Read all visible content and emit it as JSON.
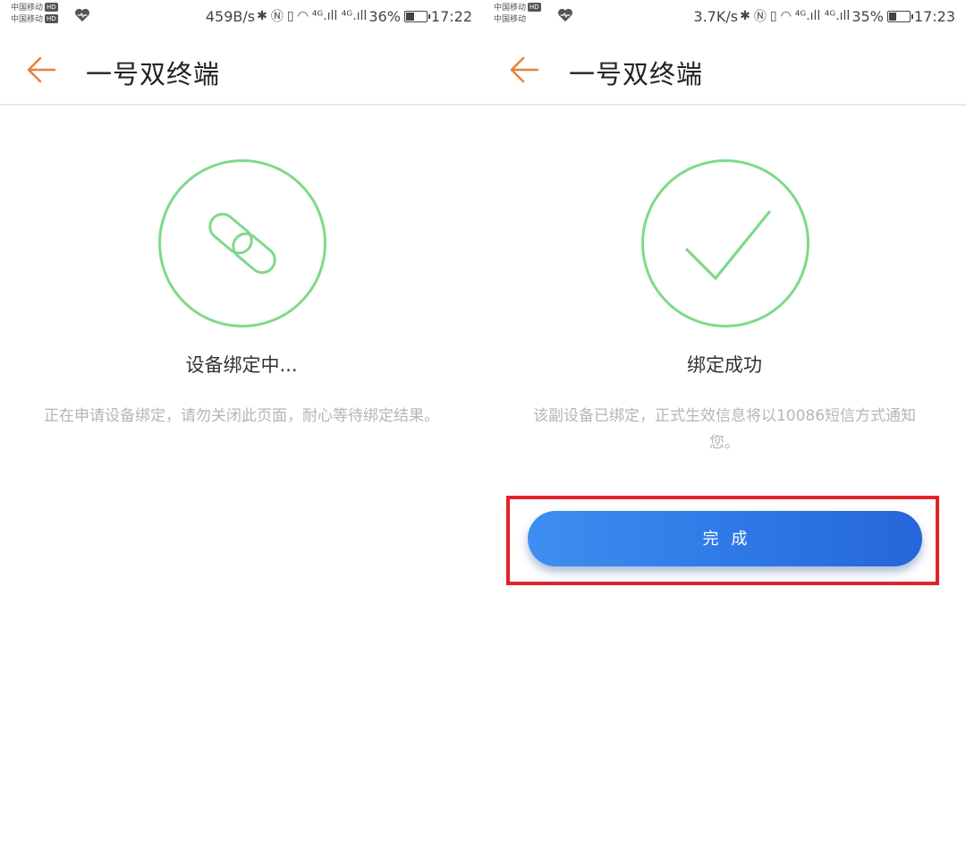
{
  "left": {
    "status": {
      "carrier1": "中国移动",
      "carrier2": "中国移动",
      "hd": "HD",
      "speed": "459B/s",
      "signal_labels": "⁴ᴳ.ıll ⁴ᴳ.ıll",
      "battery": "36%",
      "battery_level": 0.36,
      "time": "17:22"
    },
    "header": {
      "title": "一号双终端"
    },
    "state_title": "设备绑定中...",
    "description": "正在申请设备绑定，请勿关闭此页面，耐心等待绑定结果。"
  },
  "right": {
    "status": {
      "carrier1": "中国移动",
      "carrier2": "中国移动",
      "hd": "HD",
      "speed": "3.7K/s",
      "signal_labels": "⁴ᴳ.ıll ⁴ᴳ.ıll",
      "battery": "35%",
      "battery_level": 0.35,
      "time": "17:23"
    },
    "header": {
      "title": "一号双终端"
    },
    "state_title": "绑定成功",
    "description": "该副设备已绑定，正式生效信息将以10086短信方式通知您。",
    "done_button": "完成"
  },
  "colors": {
    "accent_back": "#e8823a",
    "circle_green": "#7fd989",
    "button_blue": "#2e78e6",
    "highlight_red": "#e0232a"
  },
  "icons": [
    "back-arrow-icon",
    "link-icon",
    "check-icon",
    "heart-icon",
    "bluetooth-icon",
    "nfc-icon",
    "vibrate-icon",
    "wifi-icon",
    "battery-icon"
  ]
}
